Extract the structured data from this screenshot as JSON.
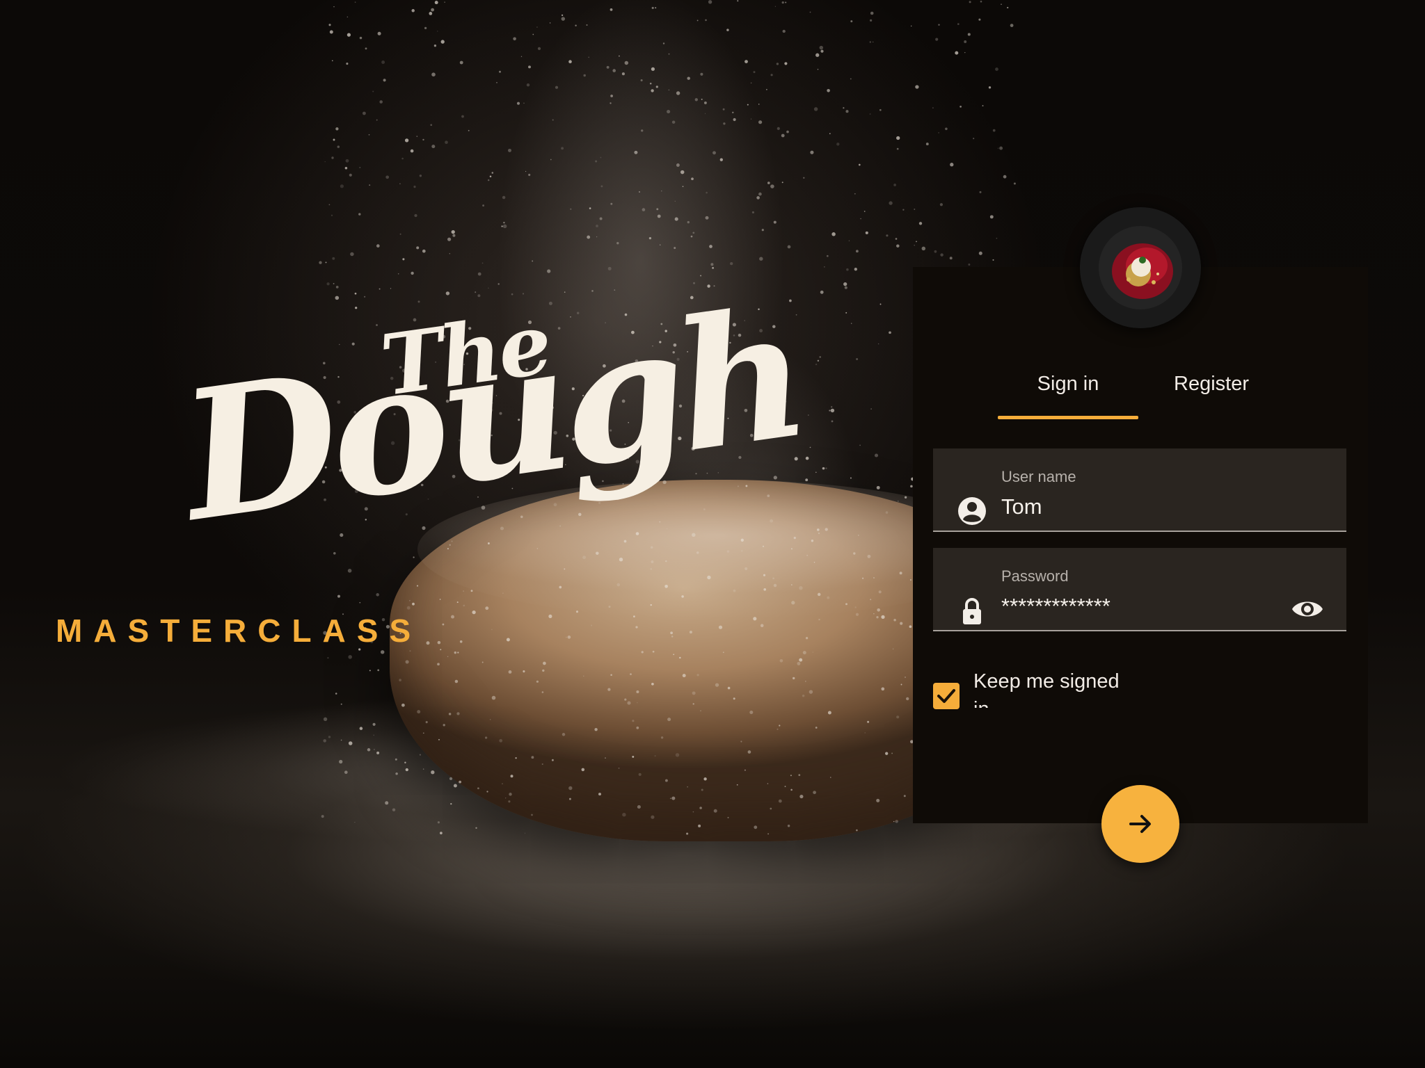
{
  "brand": {
    "line1": "The",
    "line2": "Dough",
    "subtitle": "MASTERCLASS"
  },
  "auth": {
    "tabs": [
      {
        "label": "Sign in",
        "active": true
      },
      {
        "label": "Register",
        "active": false
      }
    ],
    "username": {
      "label": "User name",
      "value": "Tom",
      "icon": "person-icon"
    },
    "password": {
      "label": "Password",
      "value": "*************",
      "icon": "lock-icon",
      "toggle_icon": "eye-icon"
    },
    "remember": {
      "label": "Keep me signed in",
      "checked": true
    },
    "submit_icon": "arrow-right-icon"
  },
  "colors": {
    "accent": "#f5ad3a",
    "panel": "#0f0b07",
    "field": "#2a2520",
    "brand_text": "#f6efe3"
  }
}
